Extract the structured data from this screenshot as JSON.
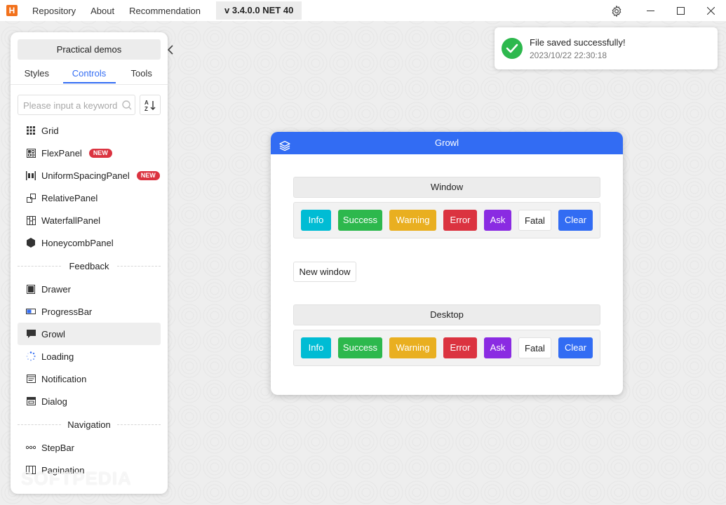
{
  "titlebar": {
    "logo_letter": "H",
    "menu": [
      "Repository",
      "About",
      "Recommendation"
    ],
    "version": "v 3.4.0.0 NET 40"
  },
  "sidebar": {
    "demos_button": "Practical demos",
    "tabs": [
      {
        "label": "Styles",
        "active": false
      },
      {
        "label": "Controls",
        "active": true
      },
      {
        "label": "Tools",
        "active": false
      }
    ],
    "search_placeholder": "Please input a keyword",
    "items": [
      {
        "label": "Grid",
        "icon": "grid-icon",
        "badge": ""
      },
      {
        "label": "FlexPanel",
        "icon": "flexpanel-icon",
        "badge": "NEW"
      },
      {
        "label": "UniformSpacingPanel",
        "icon": "uniform-spacing-icon",
        "badge": "NEW"
      },
      {
        "label": "RelativePanel",
        "icon": "relativepanel-icon",
        "badge": ""
      },
      {
        "label": "WaterfallPanel",
        "icon": "waterfall-icon",
        "badge": ""
      },
      {
        "label": "HoneycombPanel",
        "icon": "honeycomb-icon",
        "badge": ""
      }
    ],
    "group_feedback": "Feedback",
    "feedback_items": [
      {
        "label": "Drawer",
        "icon": "drawer-icon"
      },
      {
        "label": "ProgressBar",
        "icon": "progressbar-icon"
      },
      {
        "label": "Growl",
        "icon": "growl-icon",
        "selected": true
      },
      {
        "label": "Loading",
        "icon": "loading-icon"
      },
      {
        "label": "Notification",
        "icon": "notification-icon"
      },
      {
        "label": "Dialog",
        "icon": "dialog-icon"
      }
    ],
    "group_navigation": "Navigation",
    "navigation_items": [
      {
        "label": "StepBar",
        "icon": "stepbar-icon"
      },
      {
        "label": "Pagination",
        "icon": "pagination-icon"
      }
    ]
  },
  "growl": {
    "title": "File saved successfully!",
    "time": "2023/10/22 22:30:18"
  },
  "dialog": {
    "title": "Growl",
    "window_section": "Window",
    "desktop_section": "Desktop",
    "buttons": [
      "Info",
      "Success",
      "Warning",
      "Error",
      "Ask",
      "Fatal",
      "Clear"
    ],
    "new_window": "New window"
  },
  "colors": {
    "primary": "#326cf3",
    "info": "#00bcd4",
    "success": "#2db84d",
    "warning": "#e9af20",
    "error": "#db3340",
    "ask": "#8a2be2"
  },
  "watermark": "SOFTPEDIA"
}
